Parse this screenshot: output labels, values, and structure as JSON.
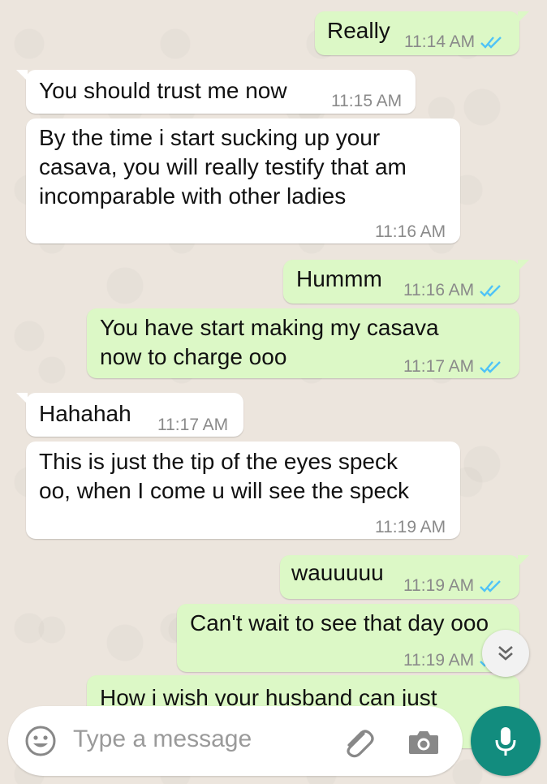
{
  "messages": [
    {
      "direction": "out",
      "text": "Really",
      "time": "11:14 AM",
      "status": "read"
    },
    {
      "direction": "in",
      "text": "You should trust me now",
      "time": "11:15 AM"
    },
    {
      "direction": "in",
      "text": "By the time i start sucking up your\ncasava, you will really testify that am\nincomparable with other ladies",
      "time": "11:16 AM"
    },
    {
      "direction": "out",
      "text": "Hummm",
      "time": "11:16 AM",
      "status": "read"
    },
    {
      "direction": "out",
      "text": "You have start making my casava\nnow to charge ooo",
      "time": "11:17 AM",
      "status": "read"
    },
    {
      "direction": "in",
      "text": "Hahahah",
      "time": "11:17 AM"
    },
    {
      "direction": "in",
      "text": "This is just the tip of the eyes speck\noo, when I come u will see the speck",
      "time": "11:19 AM"
    },
    {
      "direction": "out",
      "text": "wauuuuu",
      "time": "11:19 AM",
      "status": "read"
    },
    {
      "direction": "out",
      "text": "Can't wait to see that day ooo",
      "time": "11:19 AM",
      "status": "read"
    },
    {
      "direction": "out",
      "text": "How i wish your husband can just",
      "time": "",
      "status": ""
    }
  ],
  "composer": {
    "placeholder": "Type a message"
  },
  "icons": {
    "emoji": "emoji-icon",
    "attach": "paperclip-icon",
    "camera": "camera-icon",
    "mic": "mic-icon",
    "scroll_down": "double-chevron-down-icon",
    "read_ticks": "double-check-icon"
  },
  "colors": {
    "background": "#ece5dd",
    "incoming_bubble": "#ffffff",
    "outgoing_bubble": "#dcf8c6",
    "read_ticks": "#4fc3f7",
    "mic_button": "#128c7e",
    "timestamp": "#8a8a8a"
  }
}
